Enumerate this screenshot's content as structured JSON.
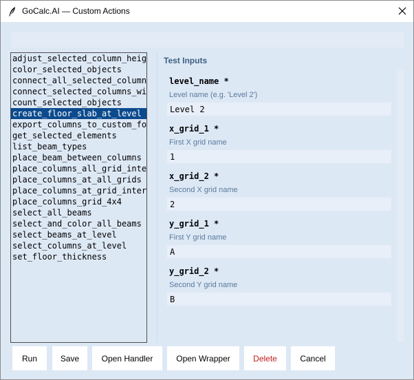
{
  "window": {
    "title": "GoCalc.AI — Custom Actions",
    "icon": "quill-icon",
    "close_icon": "close-icon"
  },
  "actions_list": {
    "items": [
      "adjust_selected_column_heigh",
      "color_selected_objects",
      "connect_all_selected_columns",
      "connect_selected_columns_wit",
      "count_selected_objects",
      "create_floor_slab_at_level",
      "export_columns_to_custom_fol",
      "get_selected_elements",
      "list_beam_types",
      "place_beam_between_columns",
      "place_columns_all_grid_inter",
      "place_columns_at_all_grids",
      "place_columns_at_grid_inters",
      "place_columns_grid_4x4",
      "select_all_beams",
      "select_and_color_all_beams",
      "select_beams_at_level",
      "select_columns_at_level",
      "set_floor_thickness"
    ],
    "selected_index": 5
  },
  "test_inputs": {
    "title": "Test Inputs",
    "fields": [
      {
        "name": "level_name *",
        "description": "Level name (e.g. 'Level 2')",
        "value": "Level 2"
      },
      {
        "name": "x_grid_1 *",
        "description": "First X grid name",
        "value": "1"
      },
      {
        "name": "x_grid_2 *",
        "description": "Second X grid name",
        "value": "2"
      },
      {
        "name": "y_grid_1 *",
        "description": "First Y grid name",
        "value": "A"
      },
      {
        "name": "y_grid_2 *",
        "description": "Second Y grid name",
        "value": "B"
      }
    ]
  },
  "buttons": {
    "run": "Run",
    "save": "Save",
    "open_handler": "Open Handler",
    "open_wrapper": "Open Wrapper",
    "delete": "Delete",
    "cancel": "Cancel"
  },
  "colors": {
    "background": "#dde8f5",
    "selection": "#0b4a8d",
    "section_title": "#3e5f82",
    "description": "#5a7a9c",
    "danger": "#c21a1a"
  }
}
